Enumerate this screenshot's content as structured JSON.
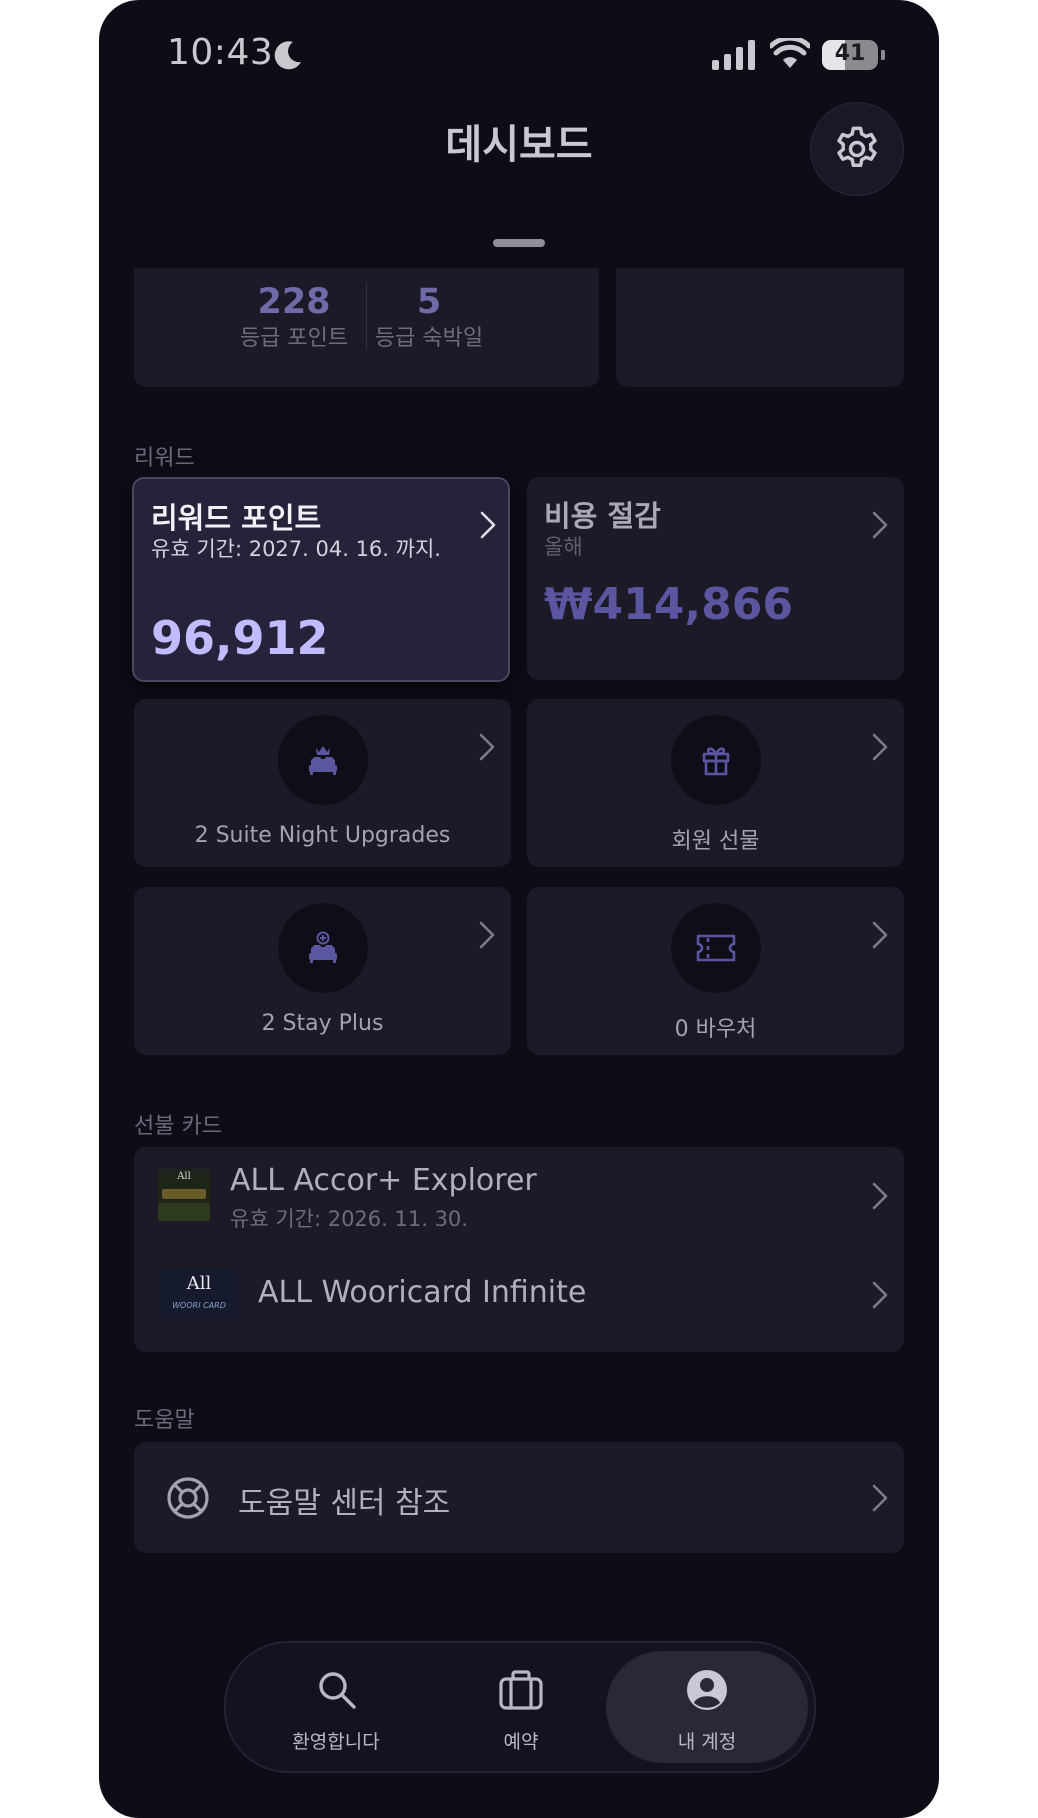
{
  "status_bar": {
    "time": "10:43",
    "battery": "41"
  },
  "header": {
    "title": "데시보드"
  },
  "tier": {
    "points_value": "228",
    "points_label": "등급 포인트",
    "nights_value": "5",
    "nights_label": "등급 숙박일"
  },
  "rewards": {
    "section_label": "리워드",
    "points_card": {
      "title": "리워드 포인트",
      "validity": "유효 기간: 2027. 04. 16. 까지.",
      "value": "96,912"
    },
    "savings_card": {
      "title": "비용 절감",
      "period": "올해",
      "value": "₩414,866"
    },
    "tiles": [
      {
        "label": "2 Suite Night Upgrades",
        "icon": "bed-crown-icon"
      },
      {
        "label": "회원 선물",
        "icon": "gift-icon"
      },
      {
        "label": "2 Stay Plus",
        "icon": "bed-plus-icon"
      },
      {
        "label": "0 바우처",
        "icon": "ticket-icon"
      }
    ]
  },
  "prepaid": {
    "section_label": "선불 카드",
    "items": [
      {
        "title": "ALL Accor+ Explorer",
        "subtitle": "유효 기간: 2026. 11. 30.",
        "thumb_text": "All"
      },
      {
        "title": "ALL Wooricard Infinite",
        "thumb_text": "All",
        "thumb_sub": "WOORI CARD"
      }
    ]
  },
  "help": {
    "section_label": "도움말",
    "item_label": "도움말 센터 참조"
  },
  "tabbar": {
    "tabs": [
      {
        "label": "환영합니다",
        "icon": "search-icon"
      },
      {
        "label": "예약",
        "icon": "briefcase-icon"
      },
      {
        "label": "내 계정",
        "icon": "account-icon",
        "active": true
      }
    ]
  },
  "colors": {
    "background": "#0e0c17",
    "card": "#1c1a27",
    "accent": "#c0bcff",
    "accent_dim": "#5a56a0"
  }
}
